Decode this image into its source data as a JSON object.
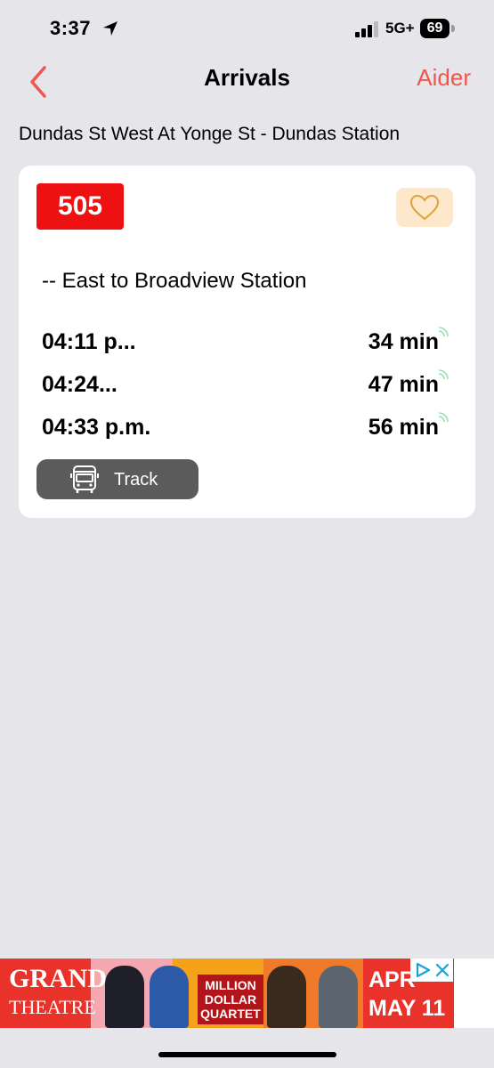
{
  "status_bar": {
    "time": "3:37",
    "network": "5G+",
    "battery": "69"
  },
  "nav": {
    "title": "Arrivals",
    "help_label": "Aider",
    "accent_color": "#f2554a"
  },
  "stop": {
    "name": "Dundas St West At Yonge St - Dundas Station"
  },
  "card": {
    "route": "505",
    "route_color": "#ee1111",
    "direction": "-- East to Broadview Station",
    "arrivals": [
      {
        "time": "04:11 p...",
        "minutes": "34 min"
      },
      {
        "time": "04:24...",
        "minutes": "47 min"
      },
      {
        "time": "04:33 p.m.",
        "minutes": "56 min"
      }
    ],
    "track_label": "Track"
  },
  "ad": {
    "brand": "GRAND",
    "brand_sub": "THEATRE",
    "show": "MILLION DOLLAR QUARTET",
    "date_line1": "APR",
    "date_line2": "MAY 11"
  },
  "icons": {
    "back": "chevron-left-icon",
    "favorite": "heart-icon",
    "live": "realtime-signal-icon",
    "track": "bus-icon"
  }
}
